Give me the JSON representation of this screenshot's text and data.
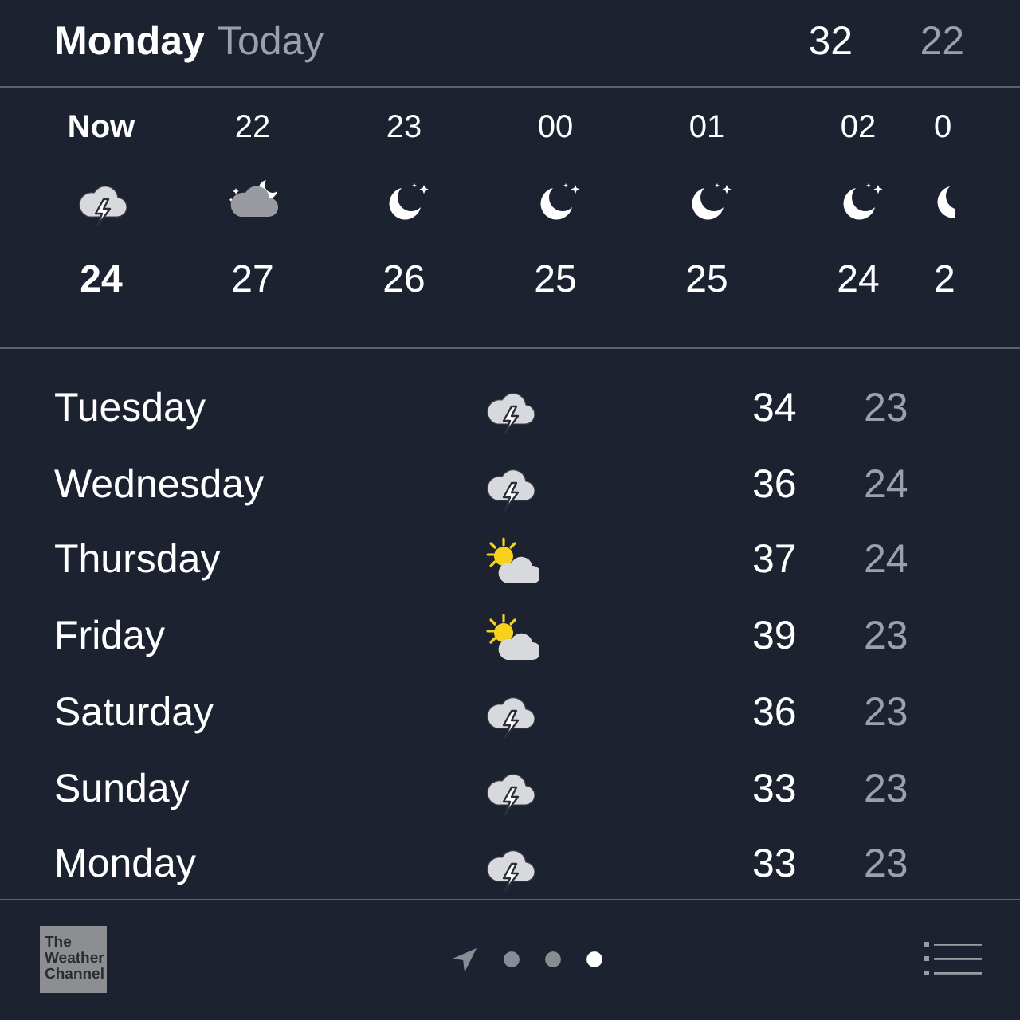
{
  "header": {
    "day": "Monday",
    "label": "Today",
    "high": "32",
    "low": "22"
  },
  "hourly": [
    {
      "time": "Now",
      "kind": "thunderstorm",
      "temp": "24",
      "current": true
    },
    {
      "time": "22",
      "kind": "partly-cloudy-night",
      "temp": "27",
      "current": false
    },
    {
      "time": "23",
      "kind": "clear-night",
      "temp": "26",
      "current": false
    },
    {
      "time": "00",
      "kind": "clear-night",
      "temp": "25",
      "current": false
    },
    {
      "time": "01",
      "kind": "clear-night",
      "temp": "25",
      "current": false
    },
    {
      "time": "02",
      "kind": "clear-night",
      "temp": "24",
      "current": false
    },
    {
      "time": "0",
      "kind": "clear-night",
      "temp": "2",
      "current": false
    }
  ],
  "daily": [
    {
      "day": "Tuesday",
      "kind": "thunderstorm",
      "high": "34",
      "low": "23"
    },
    {
      "day": "Wednesday",
      "kind": "thunderstorm",
      "high": "36",
      "low": "24"
    },
    {
      "day": "Thursday",
      "kind": "partly-sunny",
      "high": "37",
      "low": "24"
    },
    {
      "day": "Friday",
      "kind": "partly-sunny",
      "high": "39",
      "low": "23"
    },
    {
      "day": "Saturday",
      "kind": "thunderstorm",
      "high": "36",
      "low": "23"
    },
    {
      "day": "Sunday",
      "kind": "thunderstorm",
      "high": "33",
      "low": "23"
    },
    {
      "day": "Monday",
      "kind": "thunderstorm",
      "high": "33",
      "low": "23"
    }
  ],
  "footer": {
    "logo": "The Weather Channel",
    "pages": [
      {
        "kind": "location",
        "selected": false
      },
      {
        "kind": "dot",
        "selected": false
      },
      {
        "kind": "dot",
        "selected": false
      },
      {
        "kind": "dot",
        "selected": true
      }
    ]
  }
}
